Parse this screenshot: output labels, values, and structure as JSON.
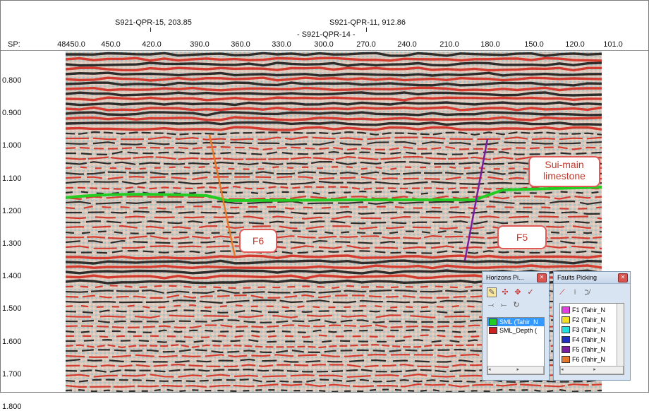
{
  "wells": [
    {
      "label": "S921-QPR-15, 203.85"
    },
    {
      "label": "S921-QPR-11, 912.86"
    },
    {
      "label": "- S921-QPR-14 -"
    }
  ],
  "sp_axis": {
    "label": "SP:",
    "ticks": [
      "48450.0",
      "450.0",
      "420.0",
      "390.0",
      "360.0",
      "330.0",
      "300.0",
      "270.0",
      "240.0",
      "210.0",
      "180.0",
      "150.0",
      "120.0",
      "101.0"
    ]
  },
  "time_axis": {
    "ticks": [
      "0.800",
      "0.900",
      "1.000",
      "1.100",
      "1.200",
      "1.300",
      "1.400",
      "1.500",
      "1.600",
      "1.700",
      "1.800"
    ]
  },
  "annotations": {
    "horizon_label": "Sui-main limestone",
    "fault_f6": "F6",
    "fault_f5": "F5"
  },
  "colors": {
    "horizon_sml": "#22cc22",
    "fault_f6": "#e8782a",
    "fault_f5": "#7a1fa0",
    "callout_border": "#e05a5a"
  },
  "horizons_panel": {
    "title": "Horizons Pi...",
    "tool_icons": [
      "pick-icon",
      "autotrack-icon",
      "autotrack2-icon",
      "check-icon",
      "seed-icon",
      "trace-icon",
      "refresh-icon"
    ],
    "items": [
      {
        "label": "SML (Tahir_N",
        "color": "#22cc22",
        "selected": true
      },
      {
        "label": "SML_Depth (",
        "color": "#cc2222",
        "selected": false
      }
    ]
  },
  "faults_panel": {
    "title": "Faults Picking",
    "tool_icons": [
      "fault-pick-icon",
      "fault-edit-icon",
      "fault-link-icon"
    ],
    "items": [
      {
        "label": "F1 (Tahir_N",
        "color": "#e040e0"
      },
      {
        "label": "F2 (Tahir_N",
        "color": "#f0e020"
      },
      {
        "label": "F3 (Tahir_N",
        "color": "#20e0e0"
      },
      {
        "label": "F4 (Tahir_N",
        "color": "#2030c0"
      },
      {
        "label": "F5 (Tahir_N",
        "color": "#7a1fa0"
      },
      {
        "label": "F6 (Tahir_N",
        "color": "#e8782a"
      }
    ]
  }
}
